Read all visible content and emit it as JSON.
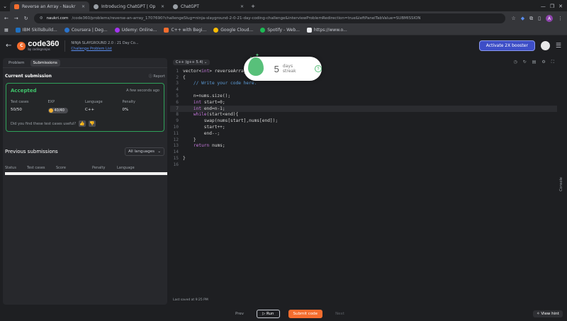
{
  "browser": {
    "tabs": [
      {
        "title": "Reverse an Array - Naukr",
        "active": true,
        "fav_color": "#f56d2e"
      },
      {
        "title": "Introducing ChatGPT | Op",
        "active": false,
        "fav_color": "#9aa0a6"
      },
      {
        "title": "ChatGPT",
        "active": false,
        "fav_color": "#9aa0a6"
      }
    ],
    "new_tab": "+",
    "url_host": "naukri.com",
    "url_path": "/code360/problems/reverse-an-array_1707690?challengeSlug=ninja-slayground-2-0-21-day-coding-challenge&interviewProblemRedirection=true&leftPanelTabValue=SUBMISSION",
    "profile_initial": "A",
    "bookmarks": [
      {
        "label": "IBM SkillsBuild...",
        "color": "#1f70c1"
      },
      {
        "label": "Coursera | Deg...",
        "color": "#2a73cc"
      },
      {
        "label": "Udemy: Online...",
        "color": "#a435f0"
      },
      {
        "label": "C++ with Begi...",
        "color": "#f56d2e"
      },
      {
        "label": "Google Cloud...",
        "color": "#fbbc04"
      },
      {
        "label": "Spotify - Web...",
        "color": "#1db954"
      },
      {
        "label": "https://www.o...",
        "color": "#e8eaed"
      }
    ]
  },
  "header": {
    "logo_main": "code360",
    "logo_sub": "by codingninjas",
    "crumb_title": "NINJA SLAYGROUND 2.0 : 21 Day Co...",
    "crumb_link": "Challenge Problem List",
    "activate_label": "Activate 2X booster"
  },
  "left": {
    "tabs": [
      "Problem",
      "Submissions"
    ],
    "current_title": "Current submission",
    "report_label": "Report",
    "status": "Accepted",
    "when": "A few seconds ago",
    "stats": [
      {
        "head": "Test cases",
        "value": "50/50"
      },
      {
        "head": "EXP",
        "value": "40/40"
      },
      {
        "head": "Language",
        "value": "C++"
      },
      {
        "head": "Penalty",
        "value": "0%"
      }
    ],
    "useful_text": "Did you find these test cases useful?",
    "previous_title": "Previous submissions",
    "language_filter": "All languages",
    "columns": [
      "Status",
      "Test cases",
      "Score",
      "Penalty",
      "Language"
    ]
  },
  "editor": {
    "language": "C++ (g++ 5.4)",
    "line_numbers": [
      "1",
      "2",
      "3",
      "4",
      "5",
      "6",
      "7",
      "8",
      "9",
      "10",
      "11",
      "12",
      "13",
      "14",
      "15",
      "16"
    ],
    "last_saved": "Last saved at 9:25 PM"
  },
  "streak": {
    "count": "5",
    "label": "days streak",
    "badge": "5"
  },
  "bottom": {
    "prev": "Prev",
    "run": "Run",
    "submit": "Submit code",
    "next": "Next",
    "hint": "View hint",
    "console": "Console"
  }
}
